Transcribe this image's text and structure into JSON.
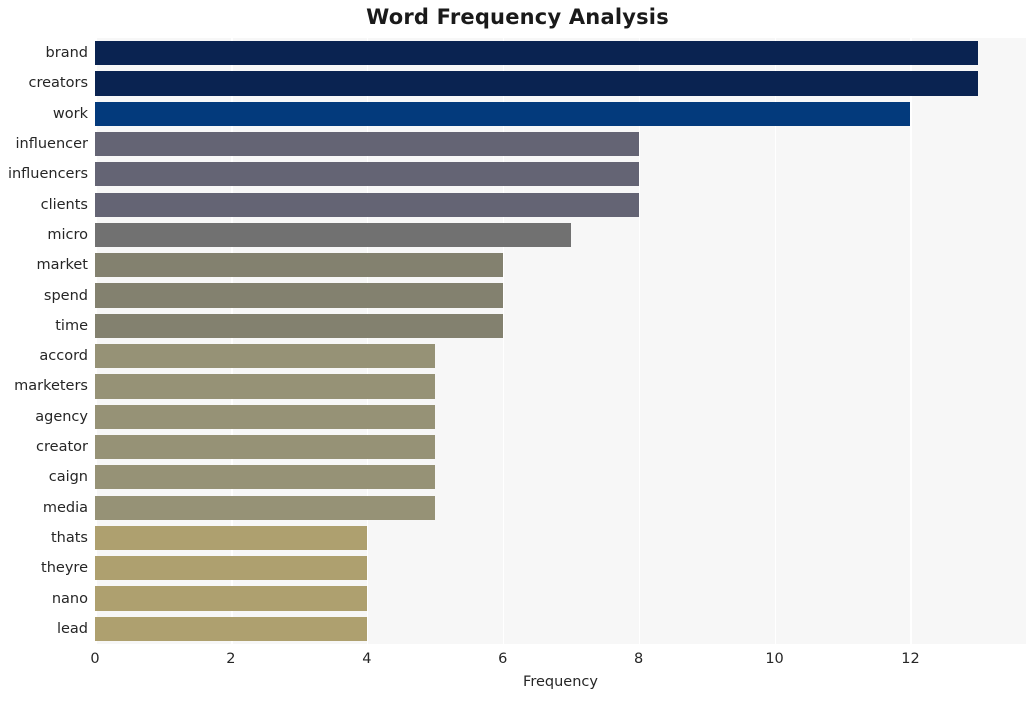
{
  "chart_data": {
    "type": "bar",
    "orientation": "horizontal",
    "title": "Word Frequency Analysis",
    "xlabel": "Frequency",
    "ylabel": "",
    "categories": [
      "brand",
      "creators",
      "work",
      "influencer",
      "influencers",
      "clients",
      "micro",
      "market",
      "spend",
      "time",
      "accord",
      "marketers",
      "agency",
      "creator",
      "caign",
      "media",
      "thats",
      "theyre",
      "nano",
      "lead"
    ],
    "values": [
      13,
      13,
      12,
      8,
      8,
      8,
      7,
      6,
      6,
      6,
      5,
      5,
      5,
      5,
      5,
      5,
      4,
      4,
      4,
      4
    ],
    "bar_colors": [
      "#0a2351",
      "#0a2351",
      "#033a7c",
      "#646474",
      "#646474",
      "#646474",
      "#717171",
      "#83816f",
      "#83816f",
      "#83816f",
      "#969276",
      "#969276",
      "#969276",
      "#969276",
      "#969276",
      "#969276",
      "#aea06f",
      "#aea06f",
      "#aea06f",
      "#aea06f"
    ],
    "xticks": [
      0,
      2,
      4,
      6,
      8,
      10,
      12
    ],
    "xtick_labels": [
      "0",
      "2",
      "4",
      "6",
      "8",
      "10",
      "12"
    ],
    "xlim": [
      0,
      13.7
    ],
    "ylim_count": 20,
    "grid": true,
    "grid_color": "#ffffff",
    "plot_background": "#f7f7f7",
    "figure_background": "#ffffff",
    "legend": null,
    "colormap": "cividis"
  }
}
